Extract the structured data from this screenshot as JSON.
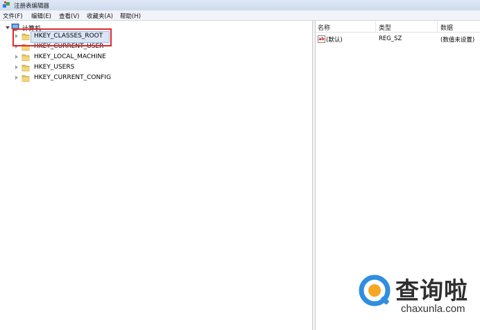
{
  "window": {
    "title": "注册表编辑器"
  },
  "menubar": {
    "items": [
      "文件(F)",
      "编辑(E)",
      "查看(V)",
      "收藏夹(A)",
      "帮助(H)"
    ]
  },
  "tree": {
    "root_label": "计算机",
    "children": [
      {
        "label": "HKEY_CLASSES_ROOT",
        "selected": true
      },
      {
        "label": "HKEY_CURRENT_USER",
        "selected": false
      },
      {
        "label": "HKEY_LOCAL_MACHINE",
        "selected": false
      },
      {
        "label": "HKEY_USERS",
        "selected": false
      },
      {
        "label": "HKEY_CURRENT_CONFIG",
        "selected": false
      }
    ]
  },
  "list": {
    "columns": [
      "名称",
      "类型",
      "数据"
    ],
    "rows": [
      {
        "name": "(默认)",
        "type": "REG_SZ",
        "data": "(数值未设置)",
        "icon": "ab"
      }
    ]
  },
  "watermark": {
    "title": "查询啦",
    "url": "chaxunla.com"
  },
  "colors": {
    "highlight": "#e2262b",
    "selection": "#dbe7f6",
    "folder": "#e8c15a"
  }
}
